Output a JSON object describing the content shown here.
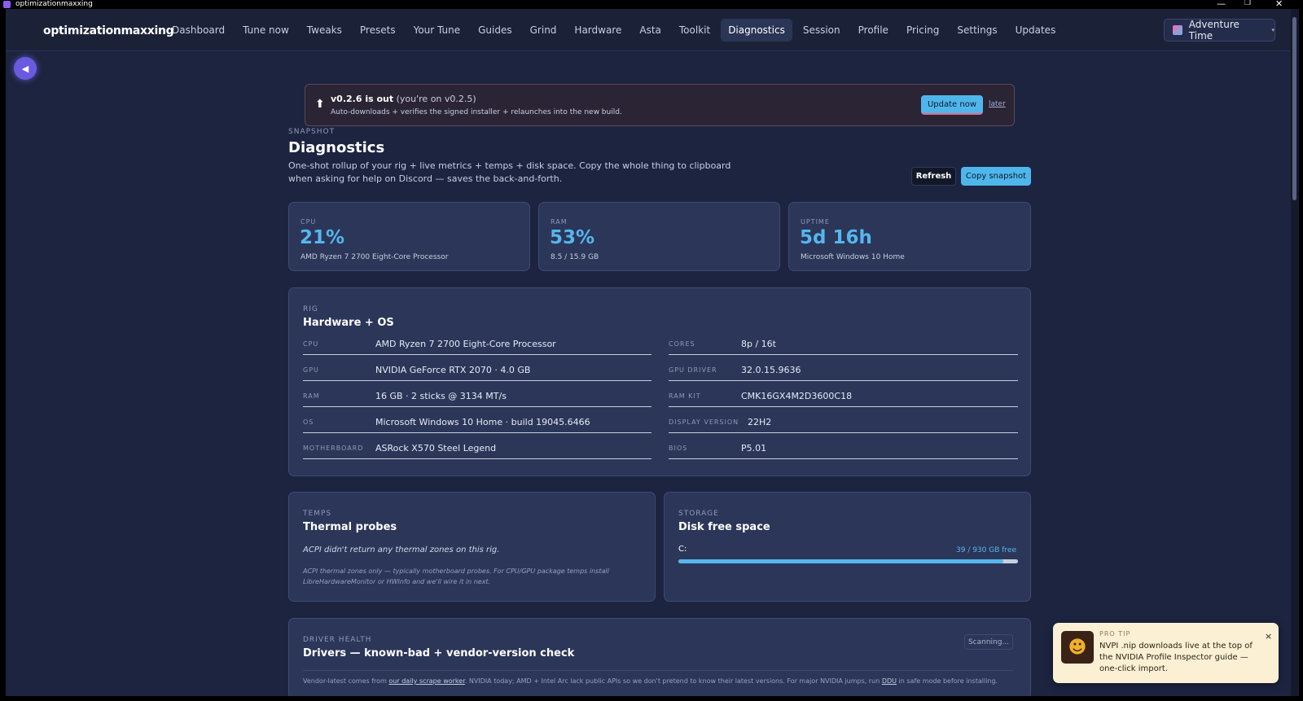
{
  "window": {
    "title": "optimizationmaxxing",
    "controls": {
      "minimize": "—",
      "maximize": "❐",
      "close": "✕"
    }
  },
  "nav": {
    "brand": "optimizationmaxxing",
    "items": [
      "Dashboard",
      "Tune now",
      "Tweaks",
      "Presets",
      "Your Tune",
      "Guides",
      "Grind",
      "Hardware",
      "Asta",
      "Toolkit",
      "Diagnostics",
      "Session",
      "Profile",
      "Pricing",
      "Settings",
      "Updates"
    ],
    "active": "Diagnostics",
    "theme": "Adventure Time",
    "theme_caret": "▾"
  },
  "icons": {
    "back": "back-arrow-icon",
    "up_arrow": "⬆",
    "toast_avatar": "☻"
  },
  "banner": {
    "title": "v0.2.6 is out",
    "current": "(you're on v0.2.5)",
    "subtitle": "Auto-downloads + verifies the signed installer + relaunches into the new build.",
    "update_label": "Update now",
    "later_label": "later"
  },
  "header": {
    "eyebrow": "SNAPSHOT",
    "title": "Diagnostics",
    "description": "One-shot rollup of your rig + live metrics + temps + disk space. Copy the whole thing to clipboard when asking for help on Discord — saves the back-and-forth.",
    "refresh_label": "Refresh",
    "copy_label": "Copy snapshot"
  },
  "stats": [
    {
      "label": "CPU",
      "value": "21%",
      "sub": "AMD Ryzen 7 2700 Eight-Core Processor"
    },
    {
      "label": "RAM",
      "value": "53%",
      "sub": "8.5 / 15.9 GB"
    },
    {
      "label": "UPTIME",
      "value": "5d 16h",
      "sub": "Microsoft Windows 10 Home"
    }
  ],
  "rig": {
    "eyebrow": "RIG",
    "title": "Hardware + OS",
    "left": [
      {
        "key": "CPU",
        "value": "AMD Ryzen 7 2700 Eight-Core Processor"
      },
      {
        "key": "GPU",
        "value": "NVIDIA GeForce RTX 2070 · 4.0 GB"
      },
      {
        "key": "RAM",
        "value": "16 GB · 2 sticks @ 3134 MT/s"
      },
      {
        "key": "OS",
        "value": "Microsoft Windows 10 Home · build 19045.6466"
      },
      {
        "key": "MOTHERBOARD",
        "value": "ASRock X570 Steel Legend"
      }
    ],
    "right": [
      {
        "key": "CORES",
        "value": "8p / 16t"
      },
      {
        "key": "GPU DRIVER",
        "value": "32.0.15.9636"
      },
      {
        "key": "RAM KIT",
        "value": "CMK16GX4M2D3600C18"
      },
      {
        "key": "DISPLAY VERSION",
        "value": "22H2"
      },
      {
        "key": "BIOS",
        "value": "P5.01"
      }
    ]
  },
  "temps": {
    "eyebrow": "TEMPS",
    "title": "Thermal probes",
    "message": "ACPI didn't return any thermal zones on this rig.",
    "note": "ACPI thermal zones only — typically motherboard probes. For CPU/GPU package temps install LibreHardwareMonitor or HWInfo and we'll wire it in next."
  },
  "storage": {
    "eyebrow": "STORAGE",
    "title": "Disk free space",
    "drive": "C:",
    "free_text": "39 / 930 GB free",
    "used_fraction": 0.958
  },
  "drivers": {
    "eyebrow": "DRIVER HEALTH",
    "title": "Drivers — known-bad + vendor-version check",
    "status": "Scanning...",
    "note_before_link": "Vendor-latest comes from ",
    "link1": "our daily scrape worker",
    "note_middle": ". NVIDIA today; AMD + Intel Arc lack public APIs so we don't pretend to know their latest versions. For major NVIDIA jumps, run ",
    "link2": "DDU",
    "note_after": " in safe mode before installing."
  },
  "toast": {
    "eyebrow": "PRO TIP",
    "text": "NVPI .nip downloads live at the top of the NVIDIA Profile Inspector guide — one-click import.",
    "close": "×"
  }
}
